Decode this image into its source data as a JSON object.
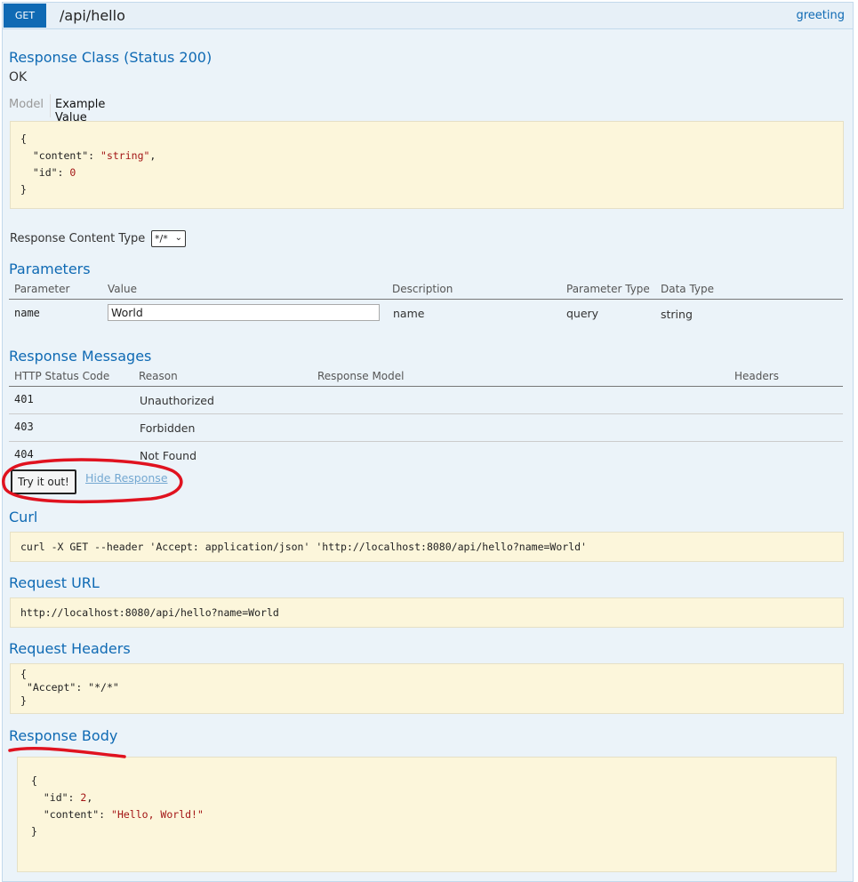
{
  "header": {
    "method": "GET",
    "path": "/api/hello",
    "nickname": "greeting"
  },
  "response_class": {
    "title": "Response Class (Status 200)",
    "status_text": "OK"
  },
  "model_tabs": {
    "model": "Model",
    "example": "Example Value"
  },
  "example_value": {
    "open": "{",
    "line1_key": "\"content\": ",
    "line1_val": "\"string\"",
    "line1_end": ",",
    "line2_key": "\"id\": ",
    "line2_val": "0",
    "close": "}"
  },
  "content_type": {
    "label": "Response Content Type",
    "selected": "*/*"
  },
  "parameters": {
    "title": "Parameters",
    "headers": [
      "Parameter",
      "Value",
      "Description",
      "Parameter Type",
      "Data Type"
    ],
    "row": {
      "name": "name",
      "value": "World",
      "description": "name",
      "param_type": "query",
      "data_type": "string"
    }
  },
  "response_messages": {
    "title": "Response Messages",
    "headers": [
      "HTTP Status Code",
      "Reason",
      "Response Model",
      "Headers"
    ],
    "rows": [
      {
        "code": "401",
        "reason": "Unauthorized"
      },
      {
        "code": "403",
        "reason": "Forbidden"
      },
      {
        "code": "404",
        "reason": "Not Found"
      }
    ]
  },
  "actions": {
    "try_label": "Try it out!",
    "hide_label": "Hide Response"
  },
  "curl": {
    "title": "Curl",
    "command": "curl -X GET --header 'Accept: application/json' 'http://localhost:8080/api/hello?name=World'"
  },
  "request_url": {
    "title": "Request URL",
    "url": "http://localhost:8080/api/hello?name=World"
  },
  "request_headers": {
    "title": "Request Headers",
    "open": "{",
    "line": "\"Accept\": \"*/*\"",
    "close": "}"
  },
  "response_body": {
    "title": "Response Body",
    "open": "{",
    "line1_key": "\"id\": ",
    "line1_val": "2",
    "line1_end": ",",
    "line2_key": "\"content\": ",
    "line2_val": "\"Hello, World!\"",
    "close": "}"
  },
  "colors": {
    "accent": "#0f6ab4",
    "annotation": "#e0121f",
    "code_bg": "#fcf6db"
  }
}
